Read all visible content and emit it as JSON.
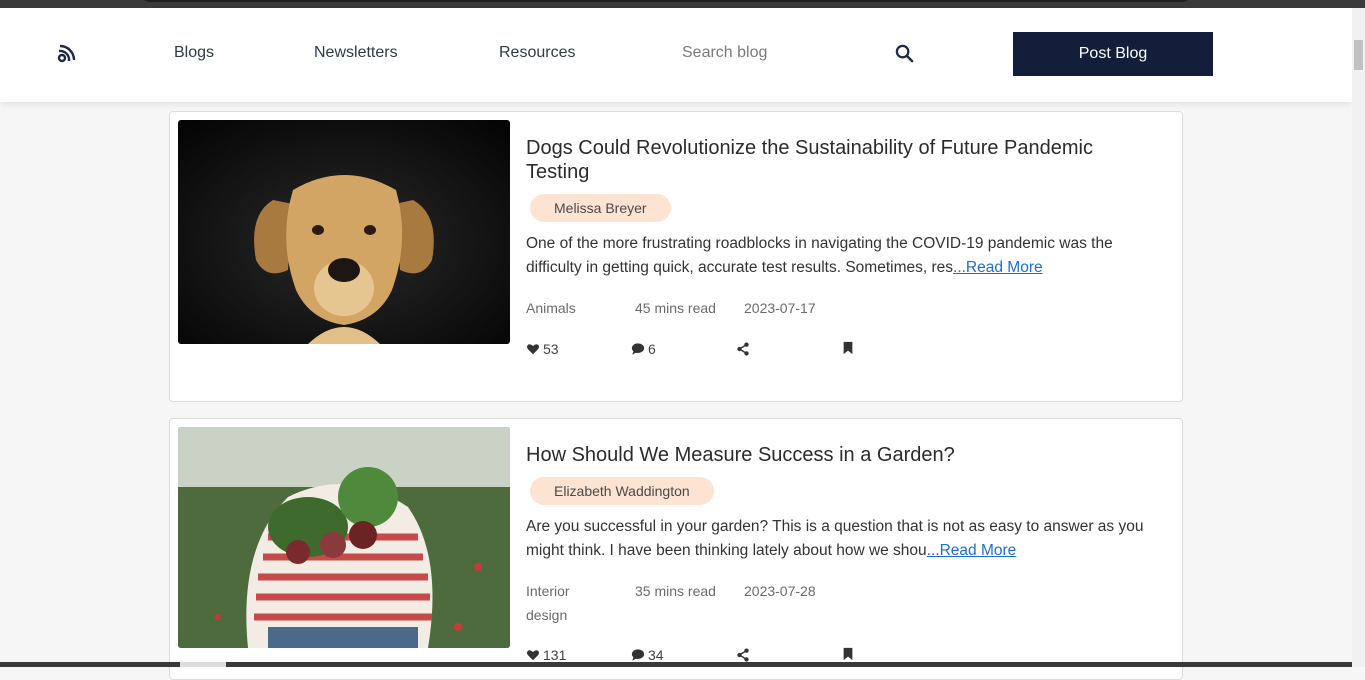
{
  "header": {
    "logo_icon": "blog-logo-icon",
    "nav": [
      "Blogs",
      "Newsletters",
      "Resources"
    ],
    "search_placeholder": "Search blog",
    "post_button": "Post Blog"
  },
  "posts": [
    {
      "title": "Dogs Could Revolutionize the Sustainability of Future Pandemic Testing",
      "author": "Melissa Breyer",
      "excerpt": "One of the more frustrating roadblocks in navigating the COVID-19 pandemic was the difficulty in getting quick, accurate test results. Sometimes, res",
      "read_more": "...Read More",
      "category": "Animals",
      "read_time": "45 mins read",
      "date": "2023-07-17",
      "likes": "53",
      "comments": "6"
    },
    {
      "title": "How Should We Measure Success in a Garden?",
      "author": "Elizabeth Waddington",
      "excerpt": "Are you successful in your garden? This is a question that is not as easy to answer as you might think. I have been thinking lately about how we shou",
      "read_more": "...Read More",
      "category": "Interior design",
      "read_time": "35 mins read",
      "date": "2023-07-28",
      "likes": "131",
      "comments": "34"
    }
  ],
  "colors": {
    "primary_button": "#131f3a",
    "author_badge": "#fce3d2",
    "link": "#1a6fd1"
  }
}
